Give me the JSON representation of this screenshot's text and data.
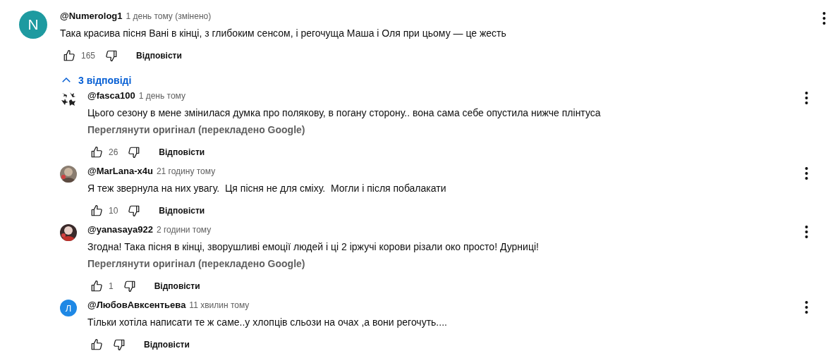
{
  "comment": {
    "avatar": {
      "kind": "letter",
      "letter": "N",
      "color": "#1e9aa0"
    },
    "author": "@Numerolog1",
    "time": "1 день тому (змінено)",
    "text": "Така красива пісня Вані в кінці, з глибоким сенсом, і регочуща Маша і Оля при цьому — це жесть",
    "likes": "165",
    "reply_label": "Відповісти"
  },
  "replies_toggle": {
    "label": "3 відповіді",
    "expanded": true
  },
  "replies": [
    {
      "avatar": {
        "kind": "pattern"
      },
      "author": "@fasca100",
      "time": "1 день тому",
      "text": "Цього сезону в мене змінилася думка про полякову, в погану сторону.. вона сама себе опустила нижче плінтуса",
      "translate_link": "Переглянути оригінал (перекладено Google)",
      "likes": "26",
      "reply_label": "Відповісти"
    },
    {
      "author": "@MarLana-x4u",
      "time": "21 годину тому",
      "text": "Я теж звернула на них увагу.  Ця пісня не для сміху.  Могли і після побалакати",
      "likes": "10",
      "reply_label": "Відповісти"
    },
    {
      "author": "@yanasaya922",
      "time": "2 години тому",
      "text": "Згодна! Така пісня в кінці, зворушливі емоції людей і ці 2 іржучі корови різали око просто! Дурниці!",
      "translate_link": "Переглянути оригінал (перекладено Google)",
      "likes": "1",
      "reply_label": "Відповісти"
    },
    {
      "avatar": {
        "kind": "letter",
        "letter": "Л",
        "color": "#1e88e5"
      },
      "author": "@ЛюбовАвксентьева",
      "time": "11 хвилин тому",
      "text": "Тільки хотіла написати те ж саме..у хлопців сльози на очах ,а вони регочуть....",
      "reply_label": "Відповісти"
    }
  ]
}
